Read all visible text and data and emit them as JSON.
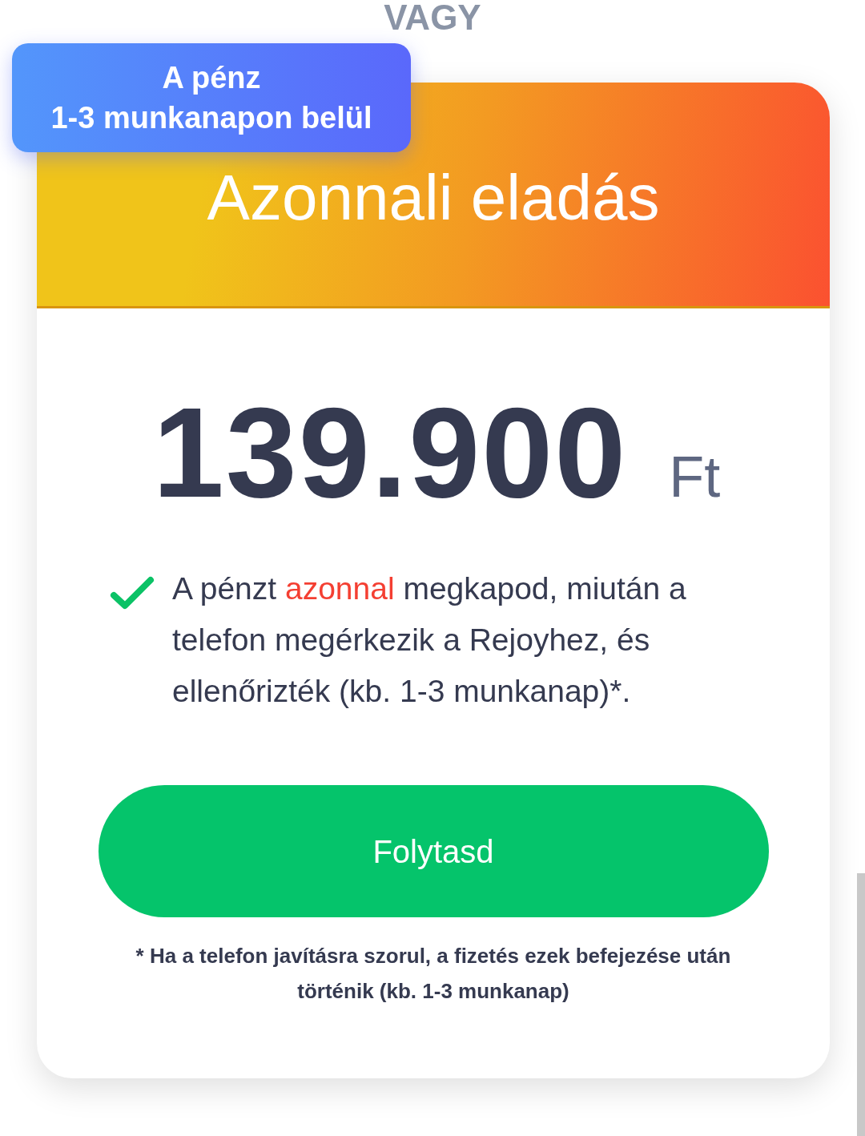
{
  "divider_label": "VAGY",
  "badge": {
    "lines": [
      "A pénz",
      "1-3 munkanapon belül"
    ]
  },
  "card": {
    "title": "Azonnali eladás",
    "price": {
      "amount": "139.900",
      "currency": "Ft"
    },
    "features": [
      {
        "segments": [
          {
            "text": "A pénzt ",
            "highlight": false
          },
          {
            "text": "azonnal",
            "highlight": true
          },
          {
            "text": " megkapod, miután a telefon megérkezik a Rejoyhez, és ellenőrizték (kb. 1-3 munkanap)*.",
            "highlight": false
          }
        ]
      }
    ],
    "button": {
      "label": "Folytasd"
    },
    "footnote": "* Ha a telefon javításra szorul, a fizetés ezek befejezése után történik (kb. 1-3 munkanap)"
  }
}
